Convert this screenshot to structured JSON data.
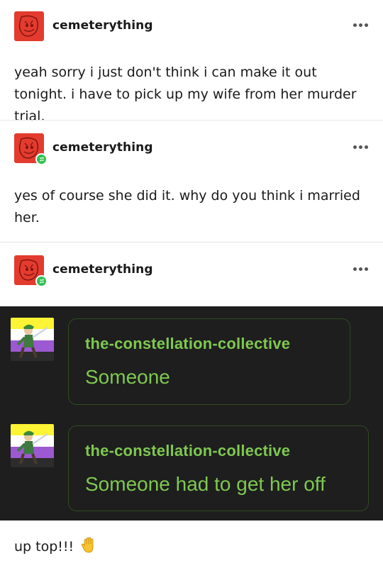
{
  "posts": [
    {
      "username": "cemeterything",
      "reblog": false,
      "text": "yeah sorry i just don't think i can make it out tonight. i have to pick up my wife from her murder trial."
    },
    {
      "username": "cemeterything",
      "reblog": true,
      "text": "yes of course she did it. why do you think i married her."
    },
    {
      "username": "cemeterything",
      "reblog": true
    }
  ],
  "screenshot": {
    "messages": [
      {
        "author": "the-constellation-collective",
        "text": "Someone"
      },
      {
        "author": "the-constellation-collective",
        "text": "Someone had to get her off"
      }
    ]
  },
  "caption": "up top!!!",
  "icons": {
    "more": "more-options-icon",
    "reblog": "reblog-icon",
    "hand": "raised-hand-icon"
  },
  "colors": {
    "accent_green": "#7ec850",
    "reblog_badge": "#2fbf4f",
    "avatar_red": "#e33b2e",
    "screenshot_bg": "#1e1e1e"
  }
}
